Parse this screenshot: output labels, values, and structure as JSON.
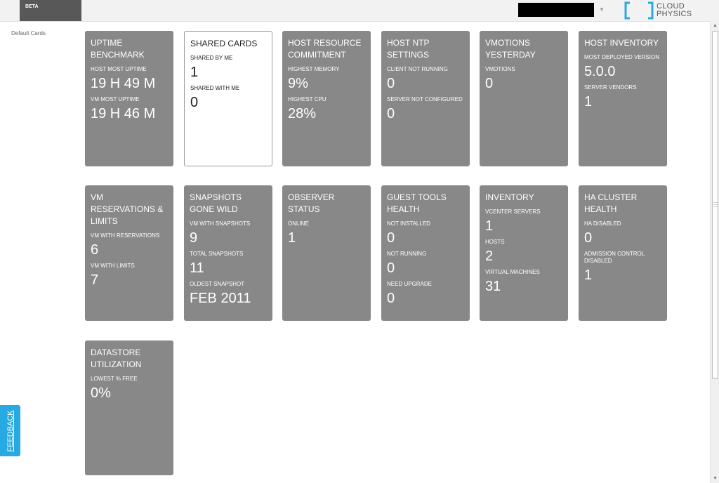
{
  "header": {
    "beta_label": "BETA"
  },
  "brand": {
    "logo_text_line1": "CLOUD",
    "logo_text_line2": "PHYSICS"
  },
  "sidebar": {
    "default_cards_link": "Default Cards"
  },
  "feedback": {
    "label": "FEEDBACK"
  },
  "cards": [
    {
      "title": "UPTIME BENCHMARK",
      "metrics": [
        {
          "label": "HOST MOST UPTIME",
          "value": "19 H 49 M"
        },
        {
          "label": "VM MOST UPTIME",
          "value": "19 H 46 M"
        }
      ]
    },
    {
      "title": "SHARED CARDS",
      "metrics": [
        {
          "label": "SHARED BY ME",
          "value": "1"
        },
        {
          "label": "SHARED WITH ME",
          "value": "0"
        }
      ]
    },
    {
      "title": "HOST RESOURCE COMMITMENT",
      "metrics": [
        {
          "label": "HIGHEST MEMORY",
          "value": "9%"
        },
        {
          "label": "HIGHEST CPU",
          "value": "28%"
        }
      ]
    },
    {
      "title": "HOST NTP SETTINGS",
      "metrics": [
        {
          "label": "CLIENT NOT RUNNING",
          "value": "0"
        },
        {
          "label": "SERVER NOT CONFIGURED",
          "value": "0"
        }
      ]
    },
    {
      "title": "VMOTIONS YESTERDAY",
      "metrics": [
        {
          "label": "VMOTIONS",
          "value": "0"
        }
      ]
    },
    {
      "title": "HOST INVENTORY",
      "metrics": [
        {
          "label": "MOST DEPLOYED VERSION",
          "value": "5.0.0"
        },
        {
          "label": "SERVER VENDORS",
          "value": "1"
        }
      ]
    },
    {
      "title": "VM RESERVATIONS & LIMITS",
      "metrics": [
        {
          "label": "VM WITH RESERVATIONS",
          "value": "6"
        },
        {
          "label": "VM WITH LIMITS",
          "value": "7"
        }
      ]
    },
    {
      "title": "SNAPSHOTS GONE WILD",
      "metrics": [
        {
          "label": "VM WITH SNAPSHOTS",
          "value": "9"
        },
        {
          "label": "TOTAL SNAPSHOTS",
          "value": "11"
        },
        {
          "label": "OLDEST SNAPSHOT",
          "value": "FEB 2011"
        }
      ]
    },
    {
      "title": "OBSERVER STATUS",
      "metrics": [
        {
          "label": "ONLINE",
          "value": "1"
        }
      ]
    },
    {
      "title": "GUEST TOOLS HEALTH",
      "metrics": [
        {
          "label": "NOT INSTALLED",
          "value": "0"
        },
        {
          "label": "NOT RUNNING",
          "value": "0"
        },
        {
          "label": "NEED UPGRADE",
          "value": "0"
        }
      ]
    },
    {
      "title": "INVENTORY",
      "metrics": [
        {
          "label": "VCENTER SERVERS",
          "value": "1"
        },
        {
          "label": "HOSTS",
          "value": "2"
        },
        {
          "label": "VIRTUAL MACHINES",
          "value": "31"
        }
      ]
    },
    {
      "title": "HA CLUSTER HEALTH",
      "metrics": [
        {
          "label": "HA DISABLED",
          "value": "0"
        },
        {
          "label": "ADMISSION CONTROL DISABLED",
          "value": "1"
        }
      ]
    },
    {
      "title": "DATASTORE UTILIZATION",
      "metrics": [
        {
          "label": "LOWEST % FREE",
          "value": "0%"
        }
      ]
    }
  ],
  "colors": {
    "card_bg": "#888888",
    "shared_card_bg": "#ffffff",
    "feedback_bg": "#27a9e1",
    "logo_blue": "#27a9e1"
  }
}
